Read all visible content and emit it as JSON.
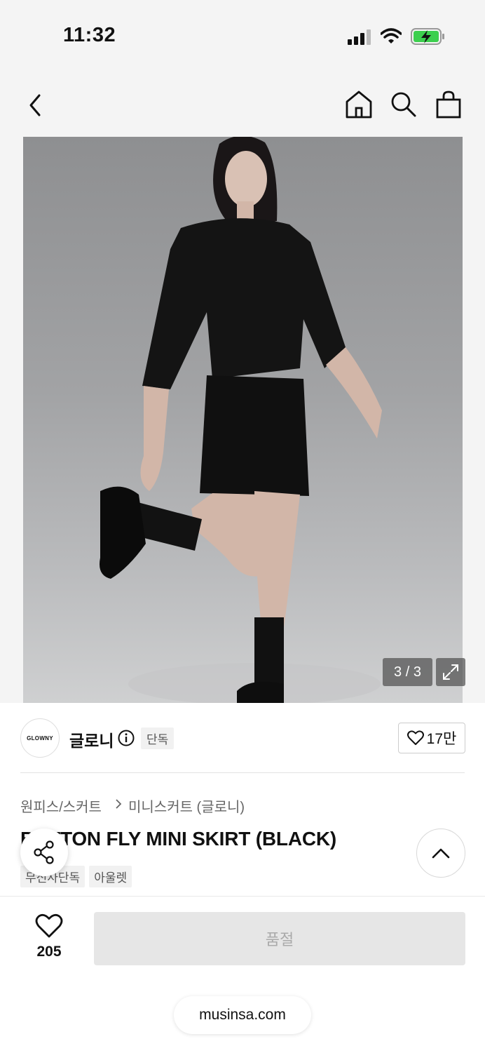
{
  "status_bar": {
    "time": "11:32"
  },
  "photo": {
    "counter": "3 / 3"
  },
  "brand": {
    "logo_text": "GLOWNY",
    "name": "글로니",
    "badge": "단독",
    "likes": "17만"
  },
  "breadcrumb": {
    "category": "원피스/스커트",
    "subcategory": "미니스커트 (글로니)"
  },
  "product": {
    "title": "BUTTON FLY MINI SKIRT (BLACK)",
    "tags": [
      "무신사단독",
      "아울렛"
    ]
  },
  "bottom_bar": {
    "like_count": "205",
    "buy_button": "품절"
  },
  "browser": {
    "url": "musinsa.com"
  },
  "colors": {
    "accent": "#111111",
    "soldout_bg": "#e6e6e6",
    "battery": "#3ccf4e"
  }
}
